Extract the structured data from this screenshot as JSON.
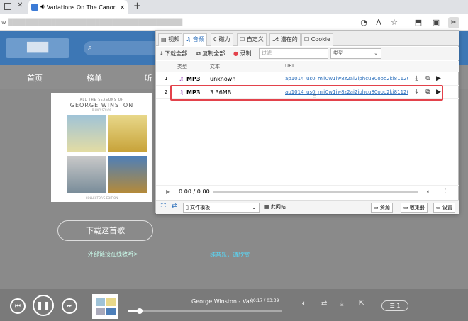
{
  "browser": {
    "tab_title": "Variations On The Canon By ...",
    "new_tab": "+",
    "url_prefix": "w",
    "url_rest": "████████████████████████████████████████",
    "reading": "A"
  },
  "site": {
    "logo": "███",
    "nav": [
      "首页",
      "榜单",
      "听"
    ]
  },
  "album": {
    "line1": "ALL THE SEASONS OF",
    "line2": "GEORGE WINSTON",
    "line3": "PIANO SOLOS",
    "line4": "COLLECTOR'S EDITION"
  },
  "page": {
    "download_btn": "下载这首歌",
    "external_link": "外部链接在线收听>",
    "promo": "纯音乐，请欣赏"
  },
  "player": {
    "song": "George Winston - Vari",
    "time": "00:17 / 03:39",
    "queue": "1",
    "progress": 0.08
  },
  "popup": {
    "tabs": [
      "视频",
      "音频",
      "磁力",
      "自定义",
      "潜在的",
      "Cookie"
    ],
    "active_tab": "音频",
    "toolbar": {
      "download_all": "下载全部",
      "copy_all": "复制全部",
      "record": "录制",
      "filter_placeholder": "过滤",
      "type_select": "类型"
    },
    "columns": [
      "类型",
      "文本",
      "URL"
    ],
    "rows": [
      {
        "index": "1",
        "type": "MP3",
        "text": "unknown",
        "url": "ap1014_us0_mii0w1iw8z2ai2iphcu80ooo2ki81120..."
      },
      {
        "index": "2",
        "type": "MP3",
        "text": "3.36MB",
        "url": "ap1014_us0_mii0w1iw8z2ai2iphcu80ooo2ki81120..."
      }
    ],
    "media_player": {
      "time": "0:00 / 0:00"
    },
    "footer": {
      "format": "文件模板",
      "this_site": "此网站",
      "resources": "资源",
      "collector": "收集器",
      "settings": "设置"
    }
  },
  "colors": {
    "accent": "#2a6ebb",
    "highlight": "#e3424b",
    "site_blue": "#3d77b5"
  }
}
